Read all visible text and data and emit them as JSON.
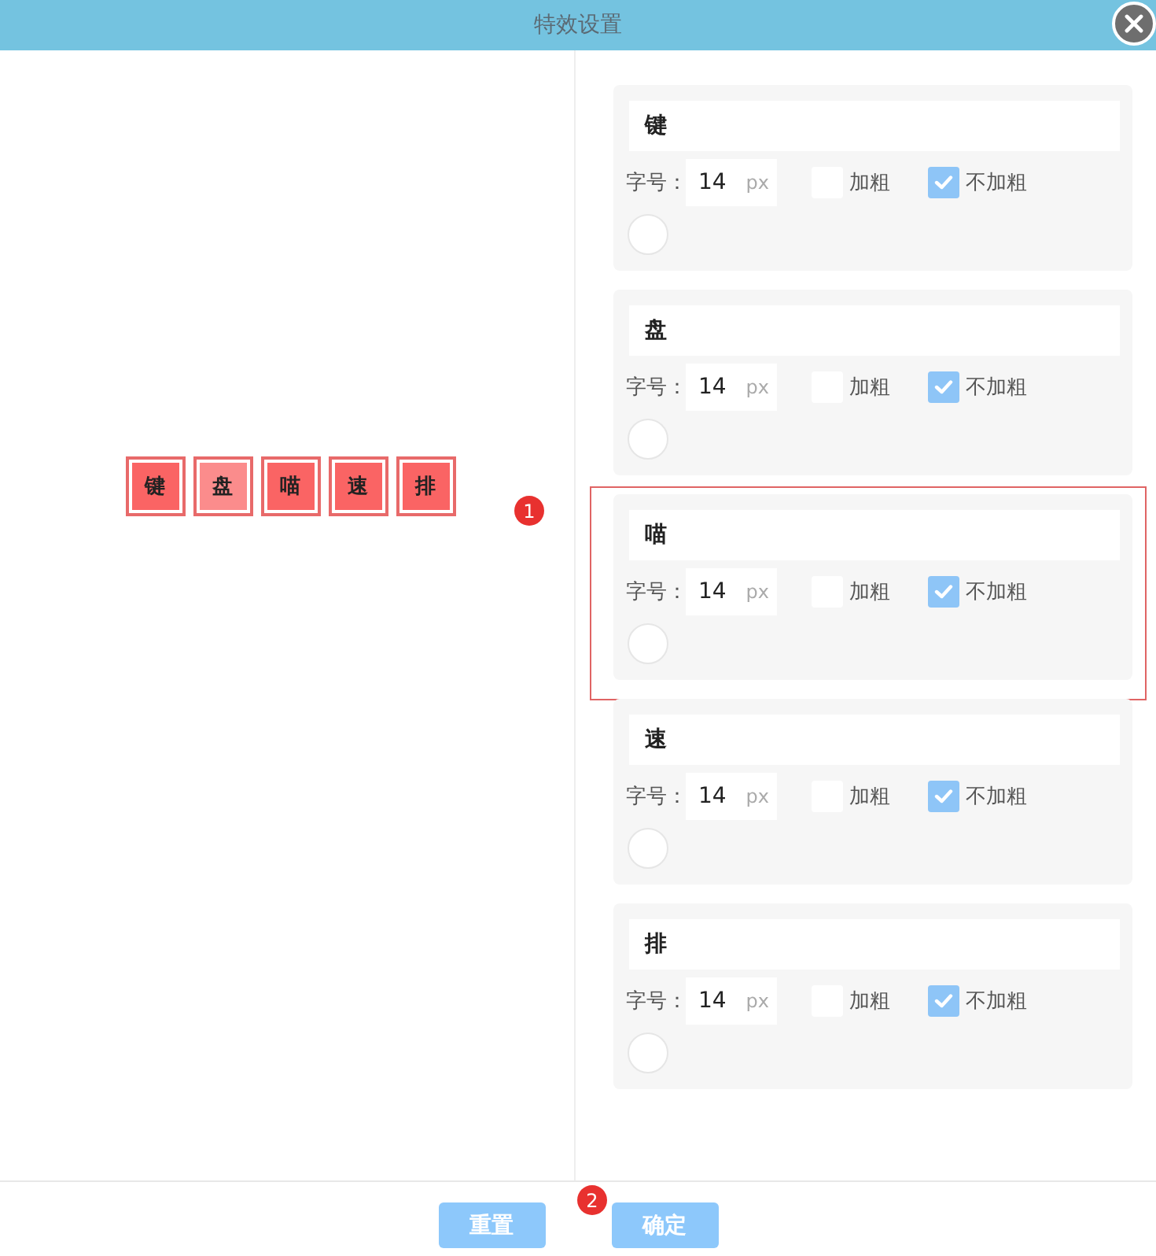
{
  "dialog": {
    "title": "特效设置"
  },
  "preview": {
    "chips": [
      {
        "text": "键",
        "color": "#fa6464"
      },
      {
        "text": "盘",
        "color": "#fb8c8c"
      },
      {
        "text": "喵",
        "color": "#fa6464"
      },
      {
        "text": "速",
        "color": "#fa6464"
      },
      {
        "text": "排",
        "color": "#fa6464"
      }
    ]
  },
  "markers": [
    {
      "label": "1"
    },
    {
      "label": "2"
    }
  ],
  "items": [
    {
      "text": "键",
      "size_label": "字号：",
      "size": "14",
      "unit": "px",
      "bold": {
        "label": "加粗",
        "checked": false
      },
      "normal": {
        "label": "不加粗",
        "checked": true
      },
      "highlighted": false
    },
    {
      "text": "盘",
      "size_label": "字号：",
      "size": "14",
      "unit": "px",
      "bold": {
        "label": "加粗",
        "checked": false
      },
      "normal": {
        "label": "不加粗",
        "checked": true
      },
      "highlighted": false
    },
    {
      "text": "喵",
      "size_label": "字号：",
      "size": "14",
      "unit": "px",
      "bold": {
        "label": "加粗",
        "checked": false
      },
      "normal": {
        "label": "不加粗",
        "checked": true
      },
      "highlighted": true
    },
    {
      "text": "速",
      "size_label": "字号：",
      "size": "14",
      "unit": "px",
      "bold": {
        "label": "加粗",
        "checked": false
      },
      "normal": {
        "label": "不加粗",
        "checked": true
      },
      "highlighted": false
    },
    {
      "text": "排",
      "size_label": "字号：",
      "size": "14",
      "unit": "px",
      "bold": {
        "label": "加粗",
        "checked": false
      },
      "normal": {
        "label": "不加粗",
        "checked": true
      },
      "highlighted": false
    }
  ],
  "buttons": [
    {
      "label": "重置"
    },
    {
      "label": "确定"
    }
  ]
}
